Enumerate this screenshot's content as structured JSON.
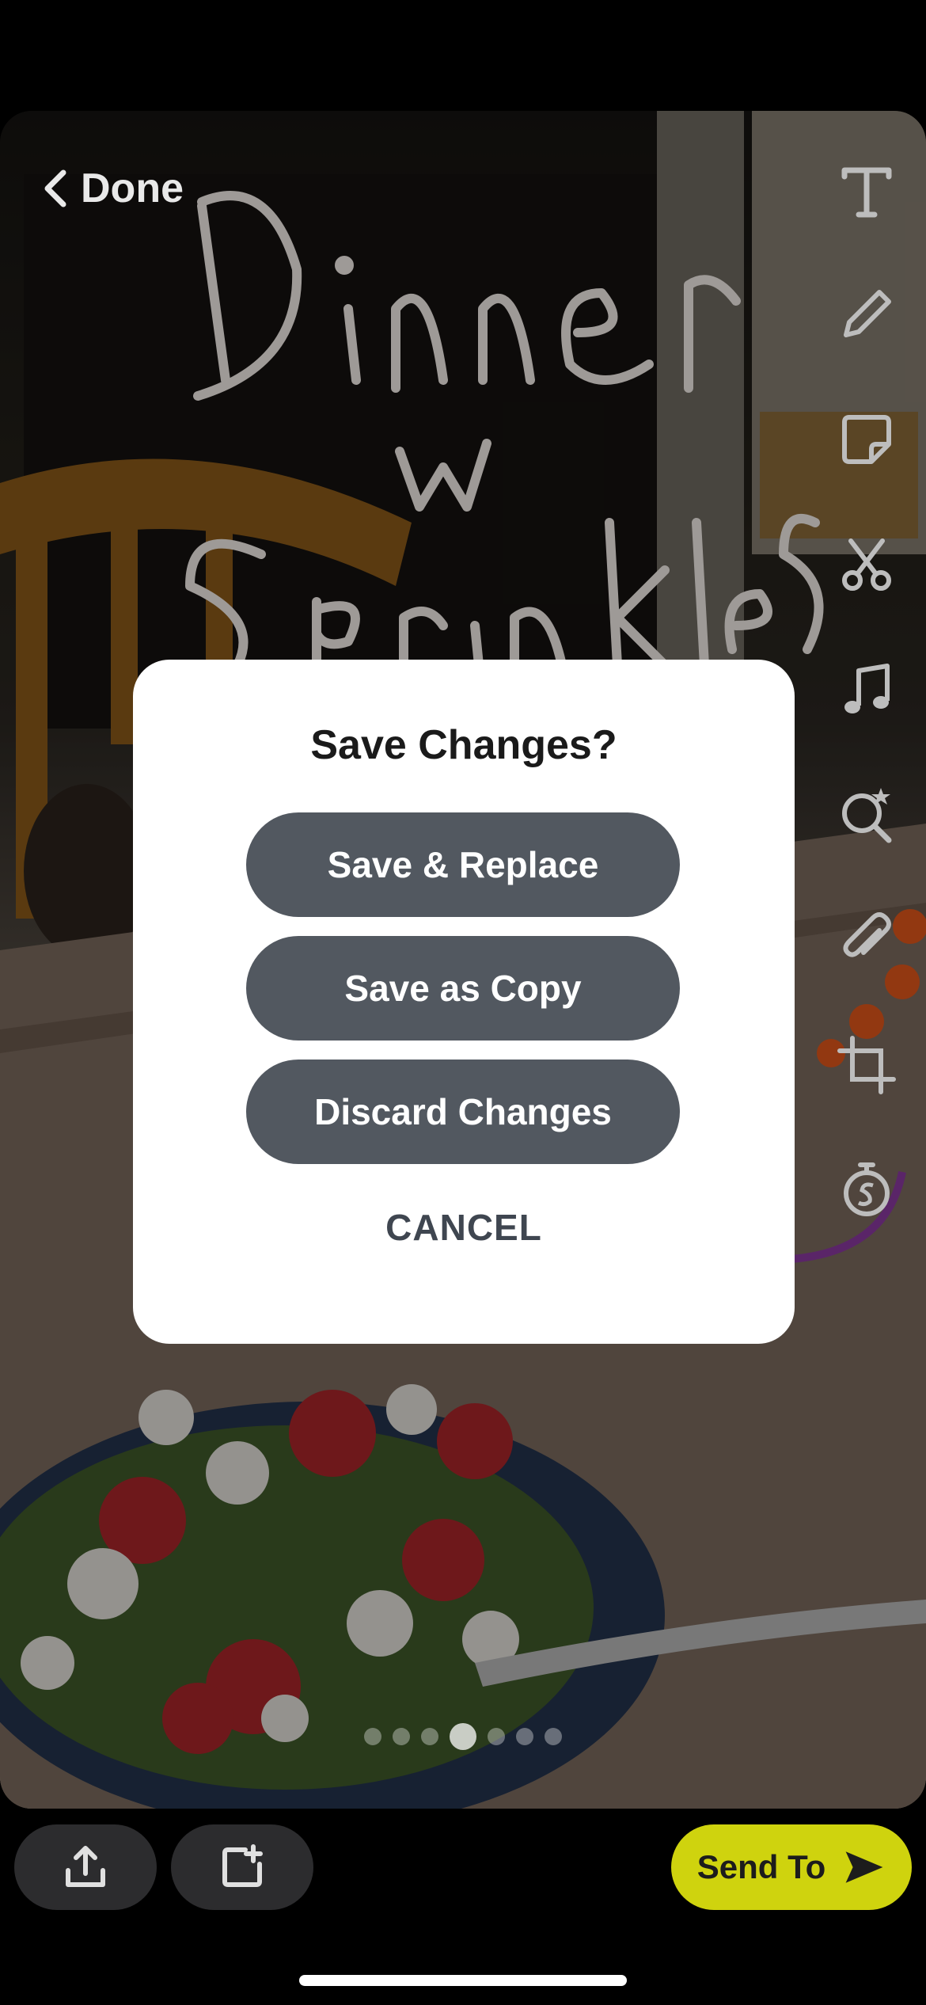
{
  "editor": {
    "done_label": "Done",
    "handwriting_text": "Dinner w Sprinkles"
  },
  "toolbar": {
    "tools": [
      "text-icon",
      "pencil-icon",
      "sticker-icon",
      "scissors-icon",
      "music-icon",
      "lens-icon",
      "attach-icon",
      "crop-icon",
      "timer-icon"
    ]
  },
  "dialog": {
    "title": "Save Changes?",
    "save_replace_label": "Save & Replace",
    "save_copy_label": "Save as Copy",
    "discard_label": "Discard Changes",
    "cancel_label": "CANCEL"
  },
  "pager": {
    "count": 7,
    "active_index": 3
  },
  "bottom_bar": {
    "send_to_label": "Send To"
  },
  "colors": {
    "accent": "#cfd30e",
    "dialog_button": "#525860",
    "dialog_bg": "#ffffff"
  }
}
